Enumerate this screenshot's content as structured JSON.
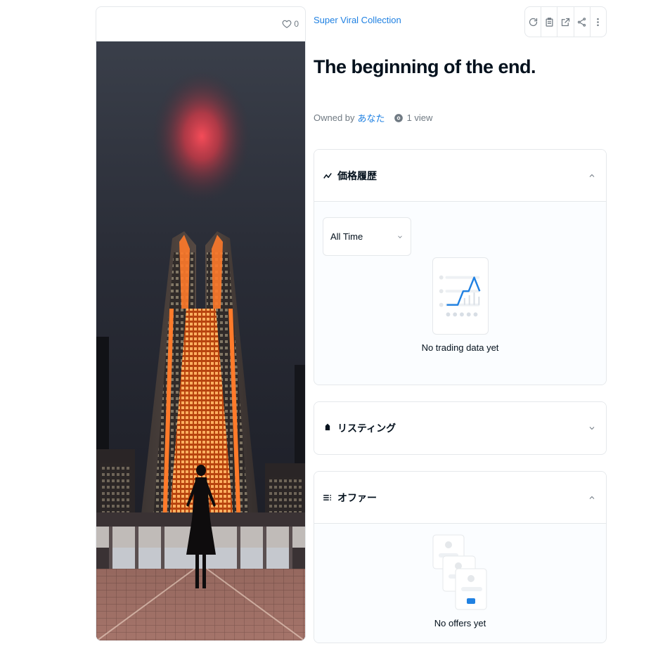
{
  "item": {
    "favorite_count": "0",
    "collection_name": "Super Viral Collection",
    "title": "The beginning of the end.",
    "owned_by_label": "Owned by",
    "owner_name": "あなた",
    "views": "1 view"
  },
  "toolbar": {
    "buttons": [
      "refresh-icon",
      "transfer-icon",
      "external-link-icon",
      "share-icon",
      "more-icon"
    ]
  },
  "price_history": {
    "title": "価格履歴",
    "range_selected": "All Time",
    "empty_text": "No trading data yet",
    "expanded": true
  },
  "listing": {
    "title": "リスティング",
    "expanded": false
  },
  "offers": {
    "title": "オファー",
    "empty_text": "No offers yet",
    "expanded": true
  },
  "colors": {
    "accent": "#2081e2",
    "text": "#04111d",
    "muted": "#707a83",
    "border": "#e5e8eb"
  }
}
